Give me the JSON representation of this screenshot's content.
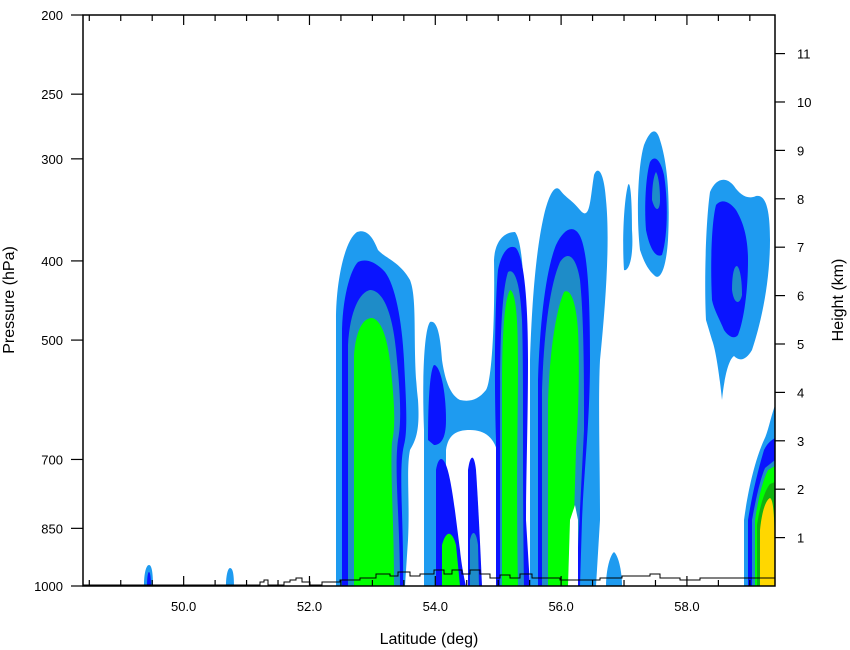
{
  "chart_data": {
    "type": "heatmap",
    "title": "",
    "xlabel": "Latitude (deg)",
    "ylabel": "Pressure (hPa)",
    "y2label": "Height (km)",
    "xlim": [
      48.4,
      59.4
    ],
    "ylim_pressure": [
      1000,
      200
    ],
    "y_scale": "log",
    "x_ticks": [
      "50.0",
      "52.0",
      "54.0",
      "56.0",
      "58.0"
    ],
    "x_tick_values": [
      50.0,
      52.0,
      54.0,
      56.0,
      58.0
    ],
    "y_ticks": [
      "200",
      "250",
      "300",
      "400",
      "500",
      "700",
      "850",
      "1000"
    ],
    "y_tick_values": [
      200,
      250,
      300,
      400,
      500,
      700,
      850,
      1000
    ],
    "y2_ticks": [
      "1",
      "2",
      "3",
      "4",
      "5",
      "6",
      "7",
      "8",
      "9",
      "10",
      "11"
    ],
    "y2_tick_values": [
      1,
      2,
      3,
      4,
      5,
      6,
      7,
      8,
      9,
      10,
      11
    ],
    "grid": false,
    "legend": "none",
    "contour_levels_colors": [
      "#1e9bf0",
      "#0a14ff",
      "#1e8cc8",
      "#00ff00",
      "#10b210",
      "#ffd700"
    ],
    "cells": [
      {
        "lat_min": 52.8,
        "lat_max": 54.0,
        "p_top": 370,
        "level": 1
      },
      {
        "lat_min": 53.9,
        "lat_max": 55.1,
        "p_top": 470,
        "level": 1
      },
      {
        "lat_min": 54.9,
        "lat_max": 55.8,
        "p_top": 340,
        "level": 4
      },
      {
        "lat_min": 55.6,
        "lat_max": 56.8,
        "p_top": 305,
        "level": 4
      },
      {
        "lat_min": 57.2,
        "lat_max": 57.9,
        "p_top": 275,
        "level": 2
      },
      {
        "lat_min": 58.4,
        "lat_max": 59.2,
        "p_top": 320,
        "level": 3
      },
      {
        "lat_min": 58.9,
        "lat_max": 59.4,
        "p_top": 640,
        "level": 6
      }
    ]
  }
}
